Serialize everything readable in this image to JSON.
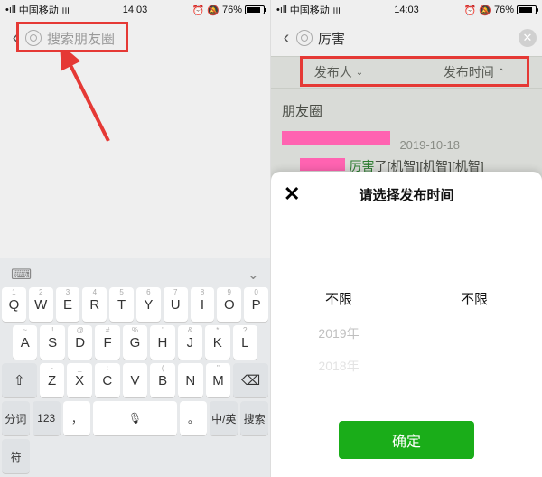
{
  "status": {
    "carrier": "中国移动",
    "time": "14:03",
    "alarm": "⏰",
    "bell": "🔔",
    "battery_pct": "76%"
  },
  "left": {
    "search_placeholder": "搜索朋友圈"
  },
  "keyboard": {
    "top_left_icon": "⌨",
    "top_right_icon": "⌄",
    "row1_nums": [
      "1",
      "2",
      "3",
      "4",
      "5",
      "6",
      "7",
      "8",
      "9",
      "0"
    ],
    "row1": [
      "Q",
      "W",
      "E",
      "R",
      "T",
      "Y",
      "U",
      "I",
      "O",
      "P"
    ],
    "row2_sym": [
      "~",
      "!",
      "@",
      "#",
      "%",
      "'",
      "&",
      "*",
      "?"
    ],
    "row2": [
      "A",
      "S",
      "D",
      "F",
      "G",
      "H",
      "J",
      "K",
      "L"
    ],
    "shift": "⇧",
    "row3_sym": [
      "-",
      "_",
      ":",
      ";",
      "(",
      "",
      "\""
    ],
    "row3": [
      "Z",
      "X",
      "C",
      "V",
      "B",
      "N",
      "M"
    ],
    "backspace": "⌫",
    "fn_left1": "分词",
    "fn_left2": "123",
    "comma": "，",
    "mic": "🎤",
    "period": "。",
    "lang": "中/英",
    "search": "搜索",
    "sym": "符"
  },
  "right": {
    "query": "厉害",
    "tab_publisher": "发布人",
    "tab_time": "发布时间",
    "section": "朋友圈",
    "post_date": "2019-10-18",
    "post_text_prefix": "厉害",
    "post_text_suffix": "了[机智][机智][机智]"
  },
  "sheet": {
    "title": "请选择发布时间",
    "unlimited": "不限",
    "year1": "2019年",
    "year2": "2018年",
    "confirm": "确定"
  }
}
